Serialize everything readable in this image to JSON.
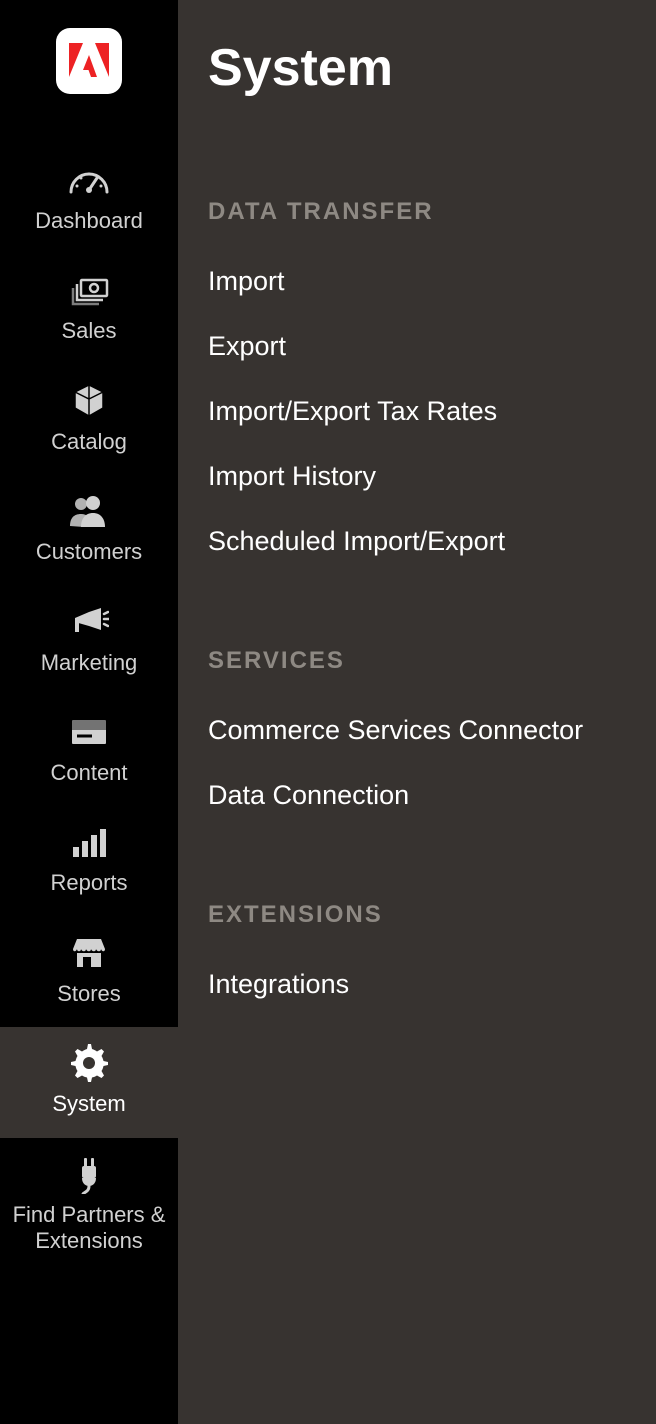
{
  "panel": {
    "title": "System",
    "groups": [
      {
        "heading": "DATA TRANSFER",
        "items": [
          "Import",
          "Export",
          "Import/Export Tax Rates",
          "Import History",
          "Scheduled Import/Export"
        ]
      },
      {
        "heading": "SERVICES",
        "items": [
          "Commerce Services Connector",
          "Data Connection"
        ]
      },
      {
        "heading": "EXTENSIONS",
        "items": [
          "Integrations"
        ]
      }
    ]
  },
  "sidebar": {
    "items": [
      {
        "label": "Dashboard"
      },
      {
        "label": "Sales"
      },
      {
        "label": "Catalog"
      },
      {
        "label": "Customers"
      },
      {
        "label": "Marketing"
      },
      {
        "label": "Content"
      },
      {
        "label": "Reports"
      },
      {
        "label": "Stores"
      },
      {
        "label": "System"
      },
      {
        "label": "Find Partners & Extensions"
      }
    ]
  }
}
